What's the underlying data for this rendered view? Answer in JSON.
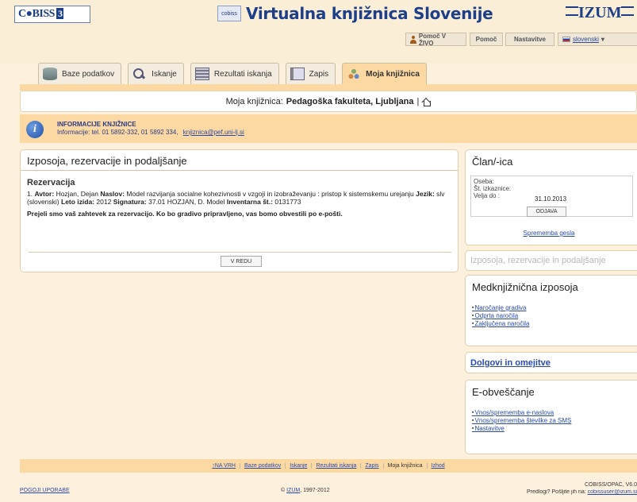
{
  "header": {
    "cobiss_logo": "C",
    "cobiss_logo_rest": "BISS",
    "cobiss_logo_box": "3",
    "site_title": "Virtualna knjižnica Slovenije",
    "mini_logo": "cobiss",
    "izum_logo": "IZUM",
    "util": {
      "live_help": "Pomoč V ŽIVO",
      "help": "Pomoč",
      "settings": "Nastavitve",
      "language": "slovenski"
    }
  },
  "tabs": [
    {
      "label": "Baze podatkov",
      "icon": "database-icon"
    },
    {
      "label": "Iskanje",
      "icon": "search-icon"
    },
    {
      "label": "Rezultati iskanja",
      "icon": "results-icon"
    },
    {
      "label": "Zapis",
      "icon": "record-icon"
    },
    {
      "label": "Moja knjižnica",
      "icon": "library-icon",
      "active": true
    }
  ],
  "library_bar": {
    "prefix": "Moja knjižnica:",
    "name": "Pedagoška fakulteta, Ljubljana",
    "separator": "|"
  },
  "info": {
    "title": "INFORMACIJE KNJIŽNICE",
    "line": "Informacije:  tel. 01 5892-332, 01 5892 334,",
    "email": "knjiznica@pef.uni-lj.si"
  },
  "main": {
    "title": "Izposoja, rezervacije in podaljšanje",
    "subtitle": "Rezervacija",
    "record": {
      "num": "1.",
      "author_label": "Avtor:",
      "author": "Hozjan, Dejan",
      "title_label": "Naslov:",
      "title": "Model razvijanja socialne kohezivnosti v vzgoji in izobraževanju : pristop k sistemskemu urejanju",
      "lang_label": "Jezik:",
      "lang": "slv (slovenski)",
      "year_label": "Leto izida:",
      "year": "2012",
      "sig_label": "Signatura:",
      "sig": "37.01 HOZJAN, D. Model",
      "inv_label": "Inventarna št.:",
      "inv": "0131773"
    },
    "note": "Prejeli smo vaš zahtevek za rezervacijo. Ko bo gradivo pripravljeno, vas bomo obvestili po e-pošti.",
    "ok_button": "V REDU"
  },
  "member": {
    "title": "Član/-ica",
    "person_label": "Oseba:",
    "card_label": "Št. izkaznice:",
    "valid_label": "Velja do :",
    "valid_value": "31.10.2013",
    "logout": "ODJAVA",
    "change_pw": "Sprememba gesla"
  },
  "loans_link": "Izposoja, rezervacije in podaljšanje",
  "ill": {
    "title": "Medknjižnična izposoja",
    "items": [
      "Naročanje gradiva",
      "Odprta naročila",
      "Zaključena naročila"
    ]
  },
  "debts": "Dolgovi in omejitve",
  "notify": {
    "title": "E-obveščanje",
    "items": [
      "Vnos/sprememba e-naslova",
      "Vnos/sprememba številke za SMS",
      "Nastavitve"
    ]
  },
  "bottom_nav": [
    {
      "label": "↑NA VRH"
    },
    {
      "label": "Baze podatkov"
    },
    {
      "label": "Iskanje"
    },
    {
      "label": "Rezultati iskanja"
    },
    {
      "label": "Zapis"
    },
    {
      "label": "Moja knjižnica",
      "current": true
    },
    {
      "label": "Izhod"
    }
  ],
  "footer": {
    "terms": "POGOJI UPORABE",
    "copy_prefix": "©",
    "copy_link": "IZUM",
    "copy_suffix": ", 1997-2012",
    "version": "COBISS/OPAC, V6.0",
    "feedback_prefix": "Predlogi? Pošljite jih na:",
    "feedback_email": "cobissuser@izum.si"
  }
}
